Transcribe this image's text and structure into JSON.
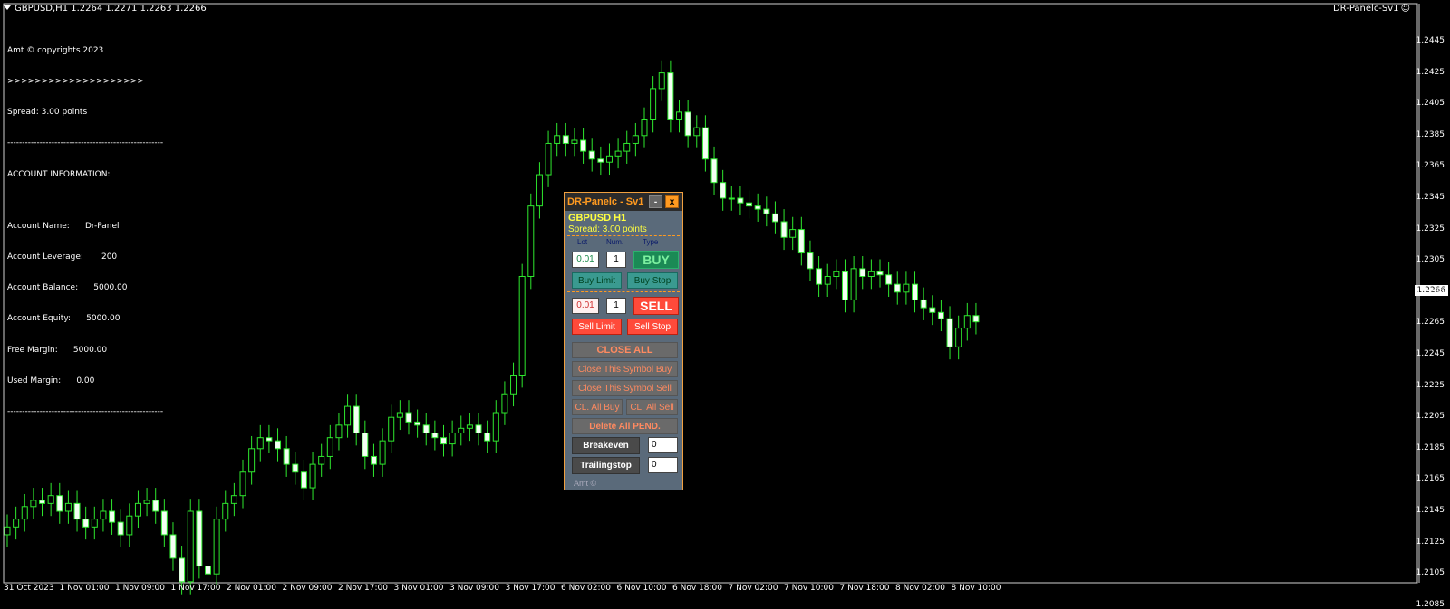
{
  "header": {
    "symbol_quote": "GBPUSD,H1  1.2264 1.2271 1.2263 1.2266"
  },
  "ea_label": "DR-Panelc-Sv1",
  "info_lines": [
    "Amt © copyrights 2023",
    ">>>>>>>>>>>>>>>>>>>>",
    "Spread: 3.00 points",
    "-----------------------------------------------------",
    "ACCOUNT INFORMATION:",
    "",
    "Account Name:      Dr-Panel",
    "Account Leverage:       200",
    "Account Balance:      5000.00",
    "Account Equity:      5000.00",
    "Free Margin:      5000.00",
    "Used Margin:      0.00",
    "-----------------------------------------------------"
  ],
  "current_price": "1.2266",
  "panel": {
    "title": "DR-Panelc - Sv1",
    "min_label": "-",
    "close_label": "x",
    "symbol": "GBPUSD  H1",
    "spread": "Spread: 3.00 points",
    "col_lot": "Lot",
    "col_num": "Num.",
    "col_type": "Type",
    "buy_lot": "0.01",
    "buy_num": "1",
    "buy_label": "BUY",
    "buy_limit": "Buy  Limit",
    "buy_stop": "Buy  Stop",
    "sell_lot": "0.01",
    "sell_num": "1",
    "sell_label": "SELL",
    "sell_limit": "Sell  Limit",
    "sell_stop": "Sell  Stop",
    "close_all": "CLOSE  ALL",
    "close_sym_buy": "Close This Symbol Buy",
    "close_sym_sell": "Close This Symbol Sell",
    "cl_all_buy": "CL. All Buy",
    "cl_all_sell": "CL. All Sell",
    "delete_pend": "Delete All PEND.",
    "breakeven": "Breakeven",
    "breakeven_val": "0",
    "trailing": "Trailingstop",
    "trailing_val": "0",
    "footer": "Amt ©"
  },
  "x_axis_labels": [
    "31 Oct 2023",
    "1 Nov 01:00",
    "1 Nov 09:00",
    "1 Nov 17:00",
    "2 Nov 01:00",
    "2 Nov 09:00",
    "2 Nov 17:00",
    "3 Nov 01:00",
    "3 Nov 09:00",
    "3 Nov 17:00",
    "6 Nov 02:00",
    "6 Nov 10:00",
    "6 Nov 18:00",
    "7 Nov 02:00",
    "7 Nov 10:00",
    "7 Nov 18:00",
    "8 Nov 02:00",
    "8 Nov 10:00"
  ],
  "y_axis_labels": [
    "1.2445",
    "1.2425",
    "1.2405",
    "1.2385",
    "1.2365",
    "1.2345",
    "1.2325",
    "1.2305",
    "1.2285",
    "1.2265",
    "1.2245",
    "1.2225",
    "1.2205",
    "1.2185",
    "1.2165",
    "1.2145",
    "1.2125",
    "1.2105",
    "1.2085"
  ],
  "chart_data": {
    "type": "candlestick",
    "close": [
      1.2135,
      1.214,
      1.2148,
      1.2152,
      1.215,
      1.2155,
      1.2145,
      1.215,
      1.214,
      1.2135,
      1.214,
      1.2145,
      1.2138,
      1.213,
      1.2142,
      1.215,
      1.2152,
      1.2145,
      1.213,
      1.2115,
      1.21,
      1.2145,
      1.211,
      1.2105,
      1.214,
      1.215,
      1.2155,
      1.217,
      1.2185,
      1.2192,
      1.219,
      1.2185,
      1.2175,
      1.217,
      1.216,
      1.2175,
      1.218,
      1.2192,
      1.22,
      1.2212,
      1.2195,
      1.218,
      1.2175,
      1.219,
      1.2205,
      1.2208,
      1.2202,
      1.22,
      1.2195,
      1.2192,
      1.2188,
      1.2195,
      1.2198,
      1.22,
      1.2195,
      1.219,
      1.2208,
      1.222,
      1.2232,
      1.2295,
      1.234,
      1.236,
      1.238,
      1.2385,
      1.238,
      1.2382,
      1.2375,
      1.237,
      1.2368,
      1.2372,
      1.2375,
      1.238,
      1.2385,
      1.2395,
      1.2415,
      1.2425,
      1.2395,
      1.24,
      1.2385,
      1.239,
      1.237,
      1.2355,
      1.2345,
      1.2345,
      1.2342,
      1.234,
      1.2338,
      1.2335,
      1.233,
      1.232,
      1.2325,
      1.231,
      1.23,
      1.229,
      1.2295,
      1.2298,
      1.228,
      1.23,
      1.2295,
      1.2298,
      1.2296,
      1.229,
      1.2285,
      1.229,
      1.228,
      1.2275,
      1.2272,
      1.2268,
      1.225,
      1.2262,
      1.227,
      1.2266
    ]
  }
}
